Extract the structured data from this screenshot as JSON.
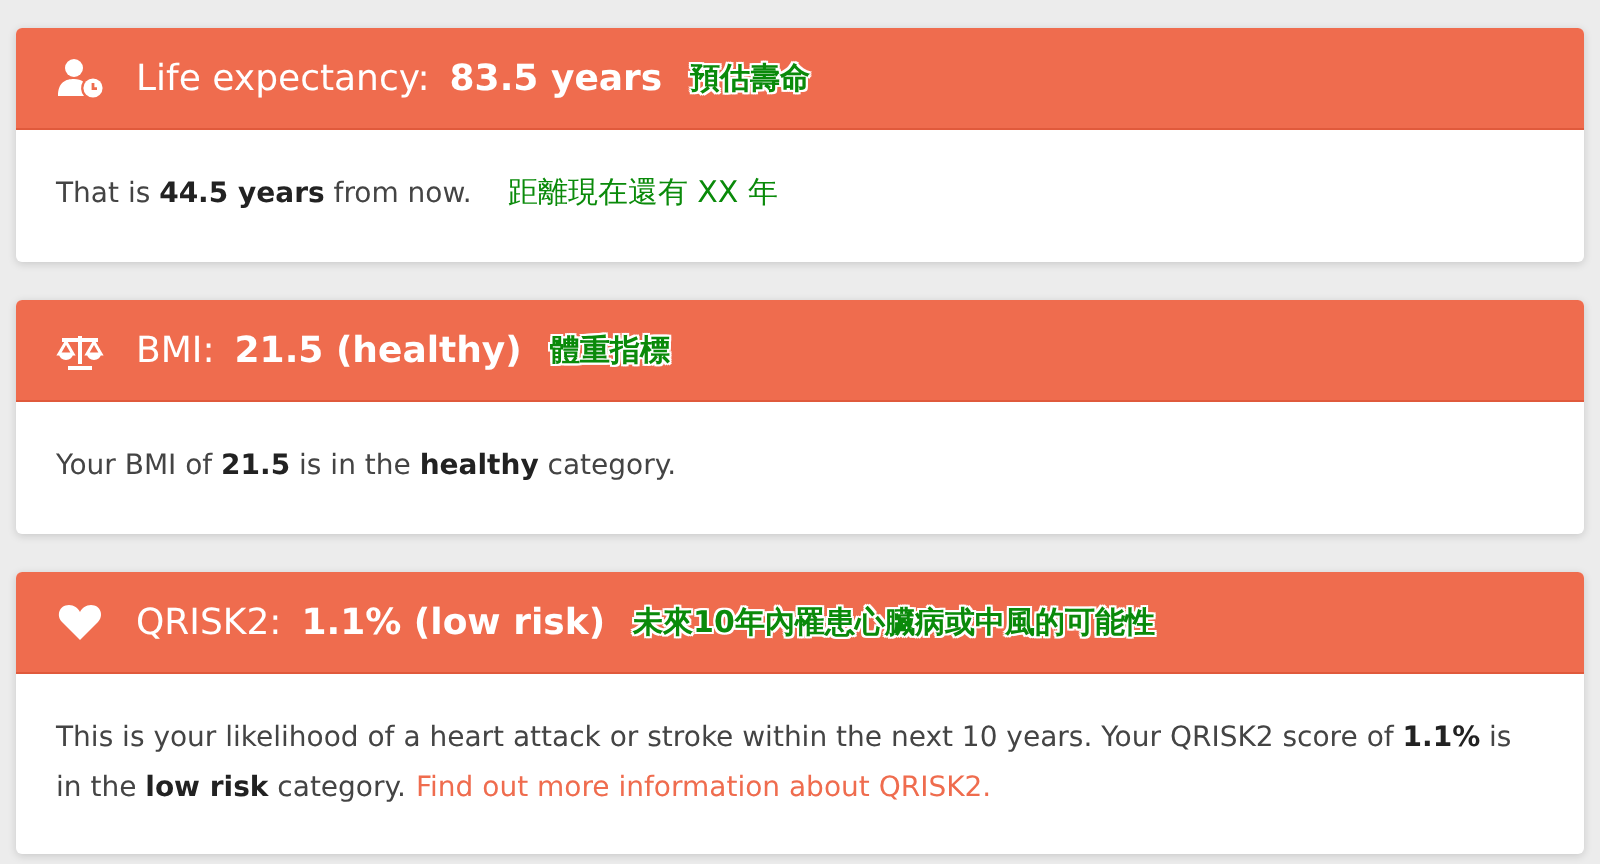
{
  "cards": [
    {
      "kind": "lifespan",
      "label": "Life expectancy:",
      "value": "83.5 years",
      "note": "預估壽命",
      "body": "That is **44.5 years** from now.",
      "body_note": "距離現在還有 XX 年"
    },
    {
      "kind": "bmi",
      "label": "BMI:",
      "value": "21.5 (healthy)",
      "note": "體重指標",
      "body": "Your BMI of **21.5** is in the **healthy** category."
    },
    {
      "kind": "risk",
      "label": "QRISK2:",
      "value": "1.1% (low risk)",
      "note": "未來10年內罹患心臟病或中風的可能性",
      "body": "This is your likelihood of a heart attack or stroke within the next 10 years. Your QRISK2 score of **1.1%** is in the **low risk** category.",
      "link": "Find out more information about QRISK2."
    }
  ]
}
